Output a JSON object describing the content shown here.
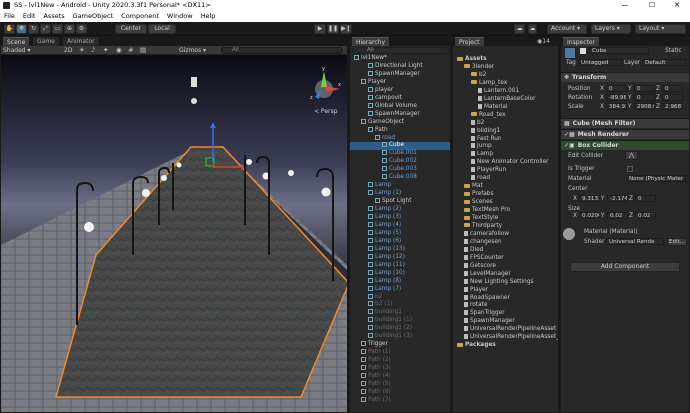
{
  "window": {
    "title": "SS - lvl1New - Android - Unity 2020.3.3f1 Personal* <DX11>",
    "minimize": "—",
    "maximize": "☐",
    "close": "✕"
  },
  "menu": [
    "File",
    "Edit",
    "Assets",
    "GameObject",
    "Component",
    "Window",
    "Help"
  ],
  "toolbar": {
    "pivot": "Center",
    "space": "Local",
    "account": "Account",
    "layers": "Layers",
    "layout": "Layout"
  },
  "scene": {
    "tabs": [
      "Scene",
      "Game",
      "Animator"
    ],
    "shading": "Shaded",
    "mode_2d": "2D",
    "gizmos": "Gizmos",
    "search_placeholder": "All",
    "persp_label": "< Persp",
    "axis_y": "y",
    "axis_x": "x",
    "axis_z": "z"
  },
  "hierarchy": {
    "title": "Hierarchy",
    "search": "All",
    "items": [
      {
        "label": "lvl1New*",
        "indent": 0,
        "cls": "scene"
      },
      {
        "label": "Directional Light",
        "indent": 2,
        "cls": ""
      },
      {
        "label": "SpawnManager",
        "indent": 2,
        "cls": ""
      },
      {
        "label": "Player",
        "indent": 1,
        "cls": ""
      },
      {
        "label": "player",
        "indent": 2,
        "cls": ""
      },
      {
        "label": "campovit",
        "indent": 2,
        "cls": ""
      },
      {
        "label": "Global Volume",
        "indent": 2,
        "cls": ""
      },
      {
        "label": "SpawnManager",
        "indent": 2,
        "cls": ""
      },
      {
        "label": "GameObject",
        "indent": 1,
        "cls": ""
      },
      {
        "label": "Path",
        "indent": 2,
        "cls": ""
      },
      {
        "label": "road",
        "indent": 3,
        "cls": "blue"
      },
      {
        "label": "Cube",
        "indent": 4,
        "cls": "sel"
      },
      {
        "label": "Cube.001",
        "indent": 4,
        "cls": "blue"
      },
      {
        "label": "Cube.002",
        "indent": 4,
        "cls": "blue"
      },
      {
        "label": "Cube.003",
        "indent": 4,
        "cls": "blue"
      },
      {
        "label": "Cube.008",
        "indent": 4,
        "cls": "blue"
      },
      {
        "label": "Lamp",
        "indent": 2,
        "cls": "blue"
      },
      {
        "label": "Lamp (1)",
        "indent": 2,
        "cls": "blue"
      },
      {
        "label": "Spot Light",
        "indent": 3,
        "cls": ""
      },
      {
        "label": "Lamp (2)",
        "indent": 2,
        "cls": "blue"
      },
      {
        "label": "Lamp (3)",
        "indent": 2,
        "cls": "blue"
      },
      {
        "label": "Lamp (4)",
        "indent": 2,
        "cls": "blue"
      },
      {
        "label": "Lamp (5)",
        "indent": 2,
        "cls": "blue"
      },
      {
        "label": "Lamp (6)",
        "indent": 2,
        "cls": "blue"
      },
      {
        "label": "Lamp (13)",
        "indent": 2,
        "cls": "blue"
      },
      {
        "label": "Lamp (12)",
        "indent": 2,
        "cls": "blue"
      },
      {
        "label": "Lamp (11)",
        "indent": 2,
        "cls": "blue"
      },
      {
        "label": "Lamp (10)",
        "indent": 2,
        "cls": "blue"
      },
      {
        "label": "Lamp (8)",
        "indent": 2,
        "cls": "blue"
      },
      {
        "label": "Lamp (7)",
        "indent": 2,
        "cls": "blue"
      },
      {
        "label": "b2",
        "indent": 2,
        "cls": "grey"
      },
      {
        "label": "b2 (1)",
        "indent": 2,
        "cls": "grey"
      },
      {
        "label": "building1",
        "indent": 2,
        "cls": "grey"
      },
      {
        "label": "building1 (1)",
        "indent": 2,
        "cls": "grey"
      },
      {
        "label": "building1 (2)",
        "indent": 2,
        "cls": "grey"
      },
      {
        "label": "building1 (3)",
        "indent": 2,
        "cls": "grey"
      },
      {
        "label": "Trigger",
        "indent": 1,
        "cls": ""
      },
      {
        "label": "Path (1)",
        "indent": 1,
        "cls": "grey"
      },
      {
        "label": "Path (2)",
        "indent": 1,
        "cls": "grey"
      },
      {
        "label": "Path (3)",
        "indent": 1,
        "cls": "grey"
      },
      {
        "label": "Path (4)",
        "indent": 1,
        "cls": "grey"
      },
      {
        "label": "Path (5)",
        "indent": 1,
        "cls": "grey"
      },
      {
        "label": "Path (6)",
        "indent": 1,
        "cls": "grey"
      },
      {
        "label": "Path (7)",
        "indent": 1,
        "cls": "grey"
      }
    ]
  },
  "project": {
    "title": "Project",
    "count": "14",
    "items": [
      {
        "label": "Assets",
        "indent": 0,
        "type": "folder"
      },
      {
        "label": "3lender",
        "indent": 1,
        "type": "folder"
      },
      {
        "label": "b2",
        "indent": 2,
        "type": "folder"
      },
      {
        "label": "Lamp_tex",
        "indent": 2,
        "type": "folder"
      },
      {
        "label": "Lantern.001",
        "indent": 3,
        "type": "file"
      },
      {
        "label": "LanternBaseColor",
        "indent": 3,
        "type": "file"
      },
      {
        "label": "Material",
        "indent": 3,
        "type": "file"
      },
      {
        "label": "Road_tex",
        "indent": 2,
        "type": "folder"
      },
      {
        "label": "b2",
        "indent": 2,
        "type": "file"
      },
      {
        "label": "bilding1",
        "indent": 2,
        "type": "file"
      },
      {
        "label": "Fast Run",
        "indent": 2,
        "type": "file"
      },
      {
        "label": "Jump",
        "indent": 2,
        "type": "file"
      },
      {
        "label": "Lamp",
        "indent": 2,
        "type": "file"
      },
      {
        "label": "New Animator Controller",
        "indent": 2,
        "type": "file"
      },
      {
        "label": "PlayerRun",
        "indent": 2,
        "type": "file"
      },
      {
        "label": "road",
        "indent": 2,
        "type": "file"
      },
      {
        "label": "Mat",
        "indent": 1,
        "type": "folder"
      },
      {
        "label": "Prefabs",
        "indent": 1,
        "type": "folder"
      },
      {
        "label": "Scenes",
        "indent": 1,
        "type": "folder"
      },
      {
        "label": "TextMesh Pro",
        "indent": 1,
        "type": "folder"
      },
      {
        "label": "TextStyle",
        "indent": 1,
        "type": "folder"
      },
      {
        "label": "Thirdparty",
        "indent": 1,
        "type": "folder"
      },
      {
        "label": "camerafollow",
        "indent": 1,
        "type": "file"
      },
      {
        "label": "changesen",
        "indent": 1,
        "type": "file"
      },
      {
        "label": "Died",
        "indent": 1,
        "type": "file"
      },
      {
        "label": "FPSCounter",
        "indent": 1,
        "type": "file"
      },
      {
        "label": "Getscore",
        "indent": 1,
        "type": "file"
      },
      {
        "label": "LevelManager",
        "indent": 1,
        "type": "file"
      },
      {
        "label": "New Lighting Settings",
        "indent": 1,
        "type": "file"
      },
      {
        "label": "Player",
        "indent": 1,
        "type": "file"
      },
      {
        "label": "RoadSpawner",
        "indent": 1,
        "type": "file"
      },
      {
        "label": "rotate",
        "indent": 1,
        "type": "file"
      },
      {
        "label": "SpanTrigger",
        "indent": 1,
        "type": "file"
      },
      {
        "label": "SpawnManager",
        "indent": 1,
        "type": "file"
      },
      {
        "label": "UniversalRenderPipelineAsset",
        "indent": 1,
        "type": "file"
      },
      {
        "label": "UniversalRenderPipelineAsset_R",
        "indent": 1,
        "type": "file"
      },
      {
        "label": "Packages",
        "indent": 0,
        "type": "folder"
      }
    ]
  },
  "inspector": {
    "title": "Inspector",
    "object_name": "Cube",
    "static_label": "Static",
    "tag_label": "Tag",
    "tag_value": "Untagged",
    "layer_label": "Layer",
    "layer_value": "Default",
    "transform": {
      "title": "Transform",
      "position_label": "Position",
      "rotation_label": "Rotation",
      "scale_label": "Scale",
      "position": {
        "x": "0",
        "y": "0",
        "z": "0"
      },
      "rotation": {
        "x": "-89.98",
        "y": "0",
        "z": "0"
      },
      "scale": {
        "x": "384.93",
        "y": "2908.6(",
        "z": "2.96871"
      }
    },
    "mesh_filter": "Cube (Mesh Filter)",
    "mesh_renderer": "Mesh Renderer",
    "box_collider": {
      "title": "Box Collider",
      "edit_label": "Edit Collider",
      "is_trigger": "Is Trigger",
      "material_label": "Material",
      "material_value": "None (Physic Mater",
      "center_label": "Center",
      "center": {
        "x": "9.313226e",
        "y": "-2.174639",
        "z": "0"
      },
      "size_label": "Size",
      "size": {
        "x": "0.020000",
        "y": "0.02",
        "z": "0.02"
      }
    },
    "material": {
      "name": "Material (Material)",
      "shader_label": "Shader",
      "shader_value": "Universal Rende",
      "edit": "Edit..."
    },
    "add_component": "Add Component"
  },
  "colors": {
    "accent": "#3d6a92",
    "selection_outline": "#f08a24",
    "unity_bg": "#191919"
  }
}
